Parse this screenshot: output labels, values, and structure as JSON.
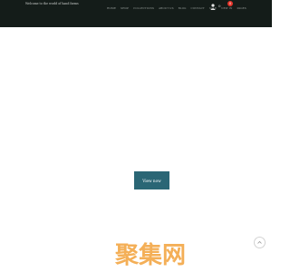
{
  "header": {
    "welcome_text": "Welcome to the world of hand farms",
    "nav": [
      "HOME",
      "SHOP",
      "COLLECTIONS",
      "ABOUT US",
      "BLOG",
      "CONTACT",
      "SALE",
      "NEW IN",
      "PAGES"
    ],
    "cart_count": "0",
    "badge_count": "0"
  },
  "hero": {
    "button_label": "View now"
  },
  "watermark": {
    "text": "聚集网",
    "color": "#f3a23a"
  },
  "icons": {
    "user": "user-icon",
    "cart": "cart-icon",
    "scroll_top": "chevron-up-icon"
  }
}
